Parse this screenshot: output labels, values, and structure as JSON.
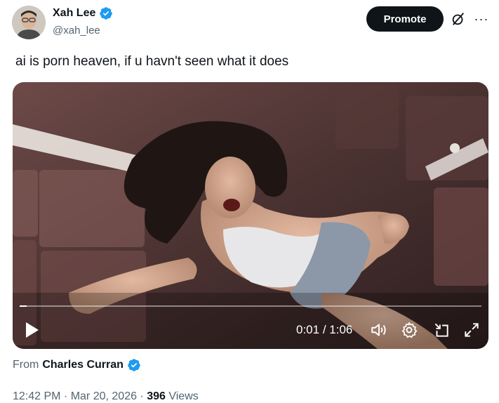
{
  "author": {
    "display_name": "Xah Lee",
    "handle": "@xah_lee"
  },
  "actions": {
    "promote_label": "Promote",
    "more_label": "···"
  },
  "tweet": {
    "text": "ai is porn heaven, if u havn't seen what it does"
  },
  "video": {
    "current_time": "0:01",
    "separator": " / ",
    "duration": "1:06",
    "progress": 0.015
  },
  "source": {
    "prefix": "From",
    "name": "Charles Curran"
  },
  "meta": {
    "time": "12:42 PM",
    "date": "Mar 20, 2026",
    "views_count": "396",
    "views_label": "Views",
    "dot": " · "
  },
  "colors": {
    "verified": "#1d9bf0",
    "secondary_text": "#536471",
    "primary_text": "#0f1419"
  },
  "icons": [
    "verified-badge-icon",
    "grok-icon",
    "more-icon",
    "play-icon",
    "volume-icon",
    "settings-icon",
    "minimize-player-icon",
    "fullscreen-icon"
  ]
}
